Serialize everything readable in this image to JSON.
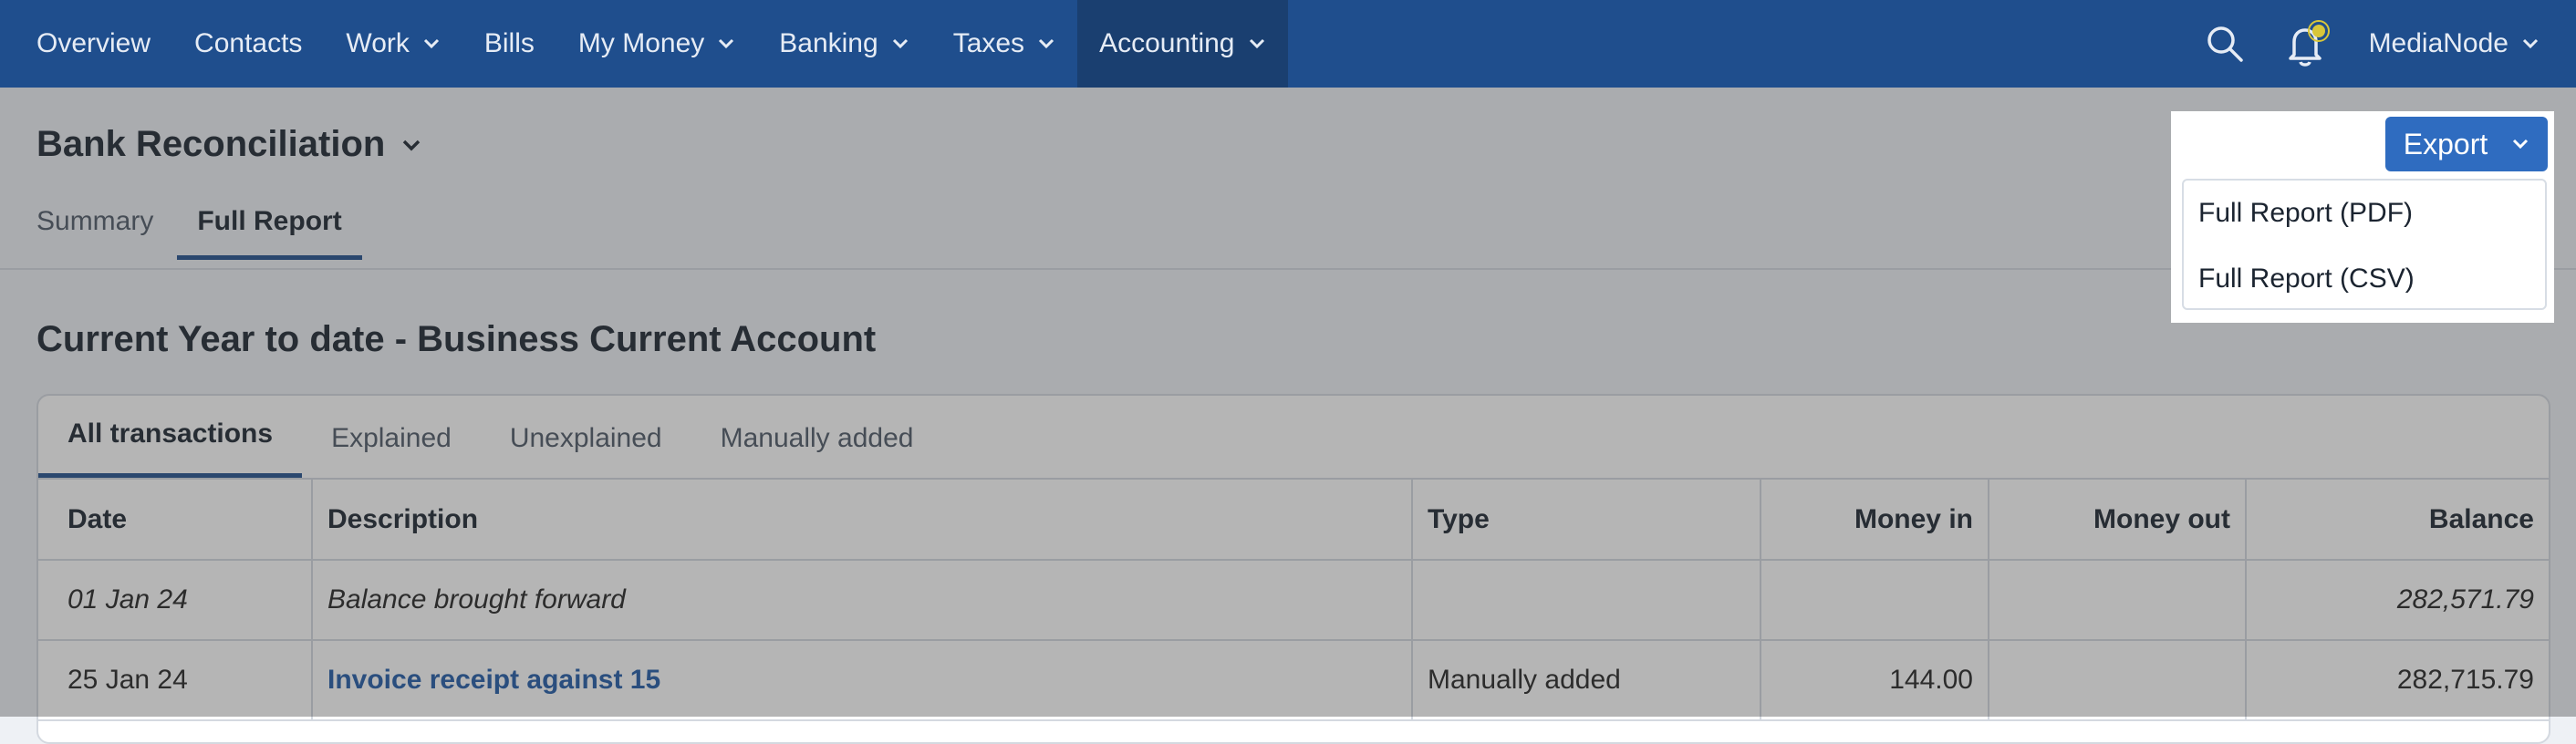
{
  "nav": {
    "items": [
      {
        "label": "Overview",
        "has_dropdown": false
      },
      {
        "label": "Contacts",
        "has_dropdown": false
      },
      {
        "label": "Work",
        "has_dropdown": true
      },
      {
        "label": "Bills",
        "has_dropdown": false
      },
      {
        "label": "My Money",
        "has_dropdown": true
      },
      {
        "label": "Banking",
        "has_dropdown": true
      },
      {
        "label": "Taxes",
        "has_dropdown": true
      },
      {
        "label": "Accounting",
        "has_dropdown": true,
        "active": true
      }
    ],
    "user": "MediaNode"
  },
  "header": {
    "title": "Bank Reconciliation",
    "tabs": [
      "Summary",
      "Full Report"
    ],
    "active_tab": "Full Report"
  },
  "section_title": "Current Year to date - Business Current Account",
  "subtabs": [
    "All transactions",
    "Explained",
    "Unexplained",
    "Manually added"
  ],
  "active_subtab": "All transactions",
  "table": {
    "columns": [
      "Date",
      "Description",
      "Type",
      "Money in",
      "Money out",
      "Balance"
    ],
    "rows": [
      {
        "date": "01 Jan 24",
        "description": "Balance brought forward",
        "type": "",
        "money_in": "",
        "money_out": "",
        "balance": "282,571.79",
        "italic": true
      },
      {
        "date": "25 Jan 24",
        "description": "Invoice receipt against 15",
        "type": "Manually added",
        "money_in": "144.00",
        "money_out": "",
        "balance": "282,715.79",
        "link": true
      }
    ]
  },
  "export": {
    "button_label": "Export",
    "menu": [
      "Full Report (PDF)",
      "Full Report (CSV)"
    ]
  },
  "colors": {
    "nav_bg": "#1f4e8d",
    "accent": "#2f6cc0",
    "notification_dot": "#d8c63a"
  }
}
